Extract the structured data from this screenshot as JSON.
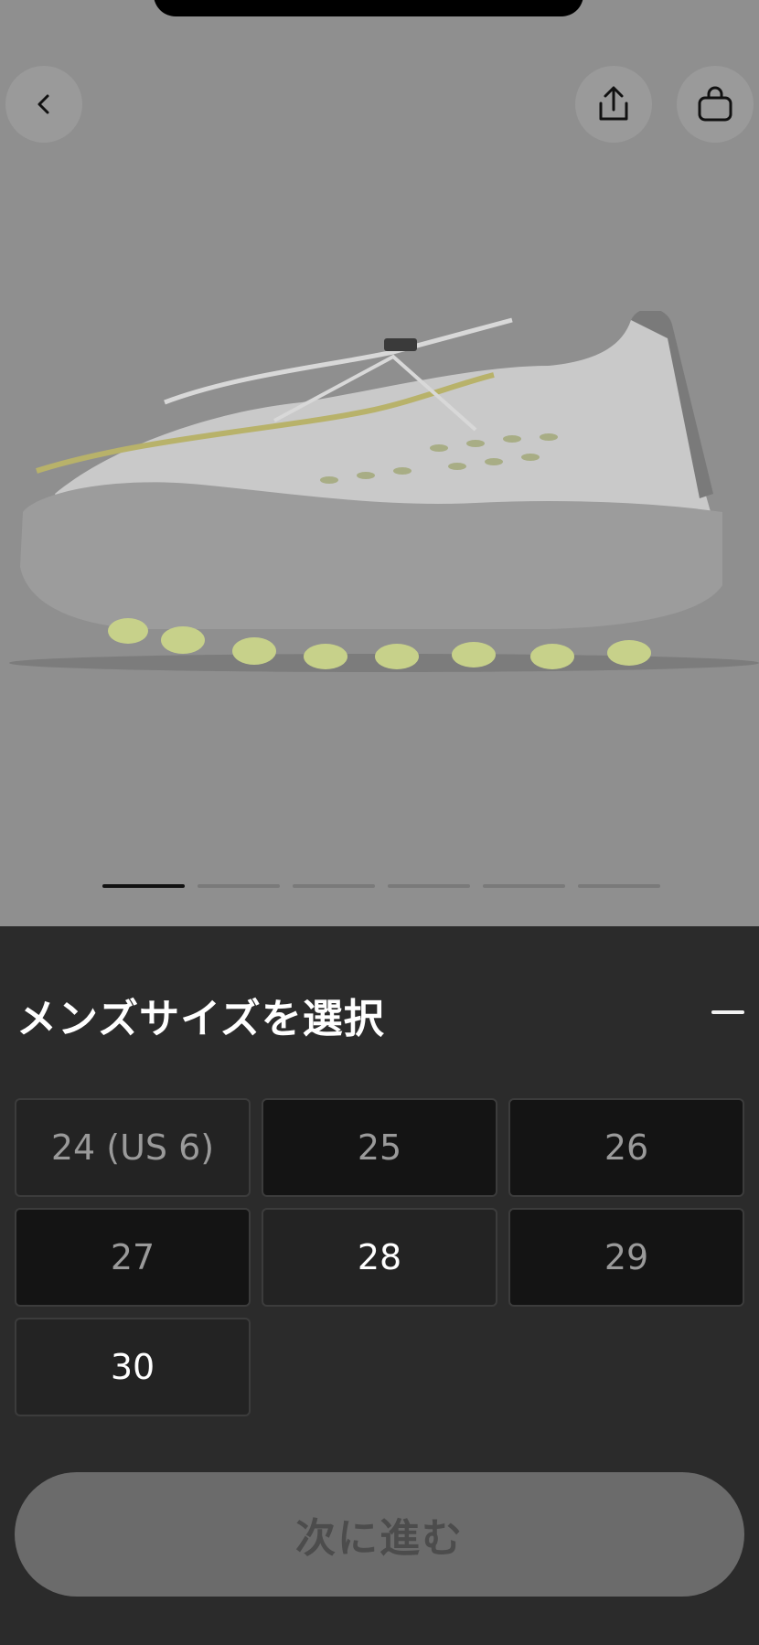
{
  "header": {
    "back_icon": "chevron-left-icon",
    "share_icon": "share-icon",
    "bag_icon": "shopping-bag-icon"
  },
  "product": {
    "image_icon": "sneaker-image",
    "pager_count": 6,
    "pager_active_index": 0
  },
  "size_sheet": {
    "title": "メンズサイズを選択",
    "sizes": [
      "24 (US 6)",
      "25",
      "26",
      "27",
      "28",
      "29",
      "30"
    ],
    "next_label": "次に進む"
  },
  "colors": {
    "sheet_bg": "#2b2b2b",
    "text_primary": "#ffffff",
    "text_muted": "#9a9a9a",
    "button_disabled": "#6b6b6b"
  }
}
